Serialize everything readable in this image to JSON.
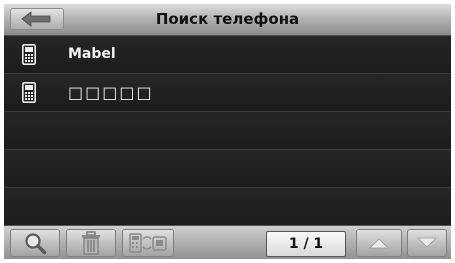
{
  "header": {
    "title": "Поиск телефона",
    "back_icon": "back-arrow-icon"
  },
  "devices": [
    {
      "name": "Mabel",
      "icon": "phone-icon"
    },
    {
      "name": "□□□□□",
      "icon": "phone-icon"
    }
  ],
  "empty_rows": 3,
  "toolbar": {
    "search_icon": "magnifier-icon",
    "delete_icon": "trash-icon",
    "pair_icon": "phone-link-icon",
    "page_indicator": "1 / 1",
    "up_icon": "arrow-up-icon",
    "down_icon": "arrow-down-icon"
  },
  "colors": {
    "background": "#1a1a1a",
    "header_gradient_top": "#dcdcdc",
    "toolbar_gradient_top": "#cfcfcf",
    "text": "#f2f2f2"
  }
}
